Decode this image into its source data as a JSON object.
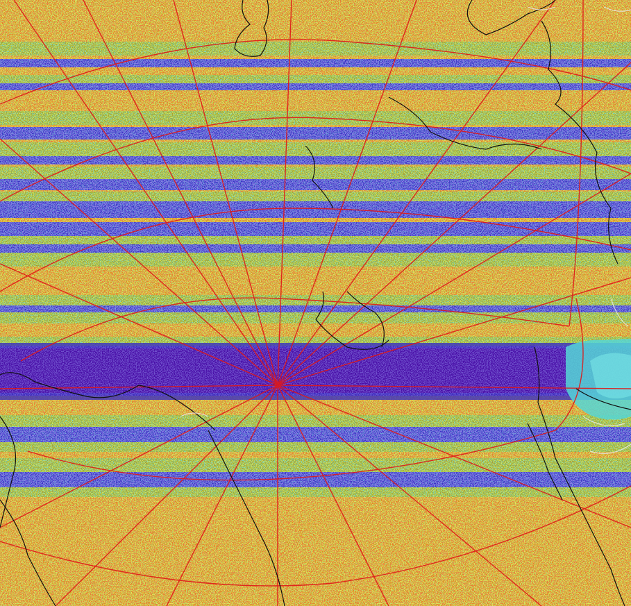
{
  "map": {
    "kind": "polar-stereographic satellite swath composite",
    "has_text": false,
    "palette": {
      "background_orange": "#e08a1a",
      "red_noise": "#e0301a",
      "yellow_noise": "#c8c81a",
      "green_noise": "#7fbf2a",
      "cyan_noise": "#2ab4b4",
      "blue_band": "#3a2fc0",
      "deep_blue_band": "#4a10a8",
      "light_cyan_patch": "#55d6d6",
      "coastline": "#101010",
      "graticule": "#e01818",
      "ice_edge": "#e8e8e8"
    },
    "layers": {
      "noise_field": true,
      "coastlines": true,
      "graticule_lines": true,
      "ice_edge_outline": true
    }
  }
}
